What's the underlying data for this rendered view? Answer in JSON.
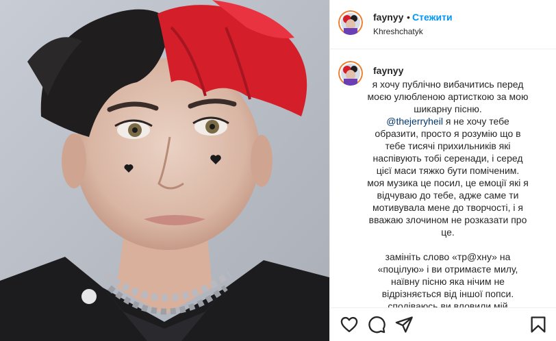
{
  "post": {
    "author": "faynyy",
    "dot_separator": "•",
    "follow_label": "Стежити",
    "location": "Khreshchatyk"
  },
  "caption": {
    "author": "faynyy",
    "line_1": "я хочу публічно вибачитись перед",
    "line_2": "моєю улюбленою артисткою за мою",
    "line_3": "шикарну пісню.",
    "mention": "@thejerryheil",
    "line_4_rest": " я не хочу тебе",
    "line_5": "образити, просто я розумію що в",
    "line_6": "тебе тисячі прихильників які",
    "line_7": "наспівують тобі серенади, і серед",
    "line_8": "цієї маси тяжко бути поміченим.",
    "line_9": "моя музика це посил, це емоції які я",
    "line_10": "відчуваю до тебе, адже саме ти",
    "line_11": "мотивувала мене до творчості, і я",
    "line_12": "вважаю злочином не розказати про",
    "line_13": "це.",
    "line_14": "замініть слово «тр@хну» на",
    "line_15": "«поцілую» і ви отримаєте милу,",
    "line_16": "наївну пісню яка нічим не",
    "line_17": "відрізняється від іншої попси.",
    "line_18": "сподіваюсь ви вловили мій"
  },
  "icons": {
    "like": "heart-icon",
    "comment": "comment-icon",
    "share": "share-icon",
    "save": "bookmark-icon"
  },
  "colors": {
    "link_blue": "#0095f6",
    "mention_blue": "#00376b",
    "text": "#262626",
    "border": "#efefef"
  }
}
